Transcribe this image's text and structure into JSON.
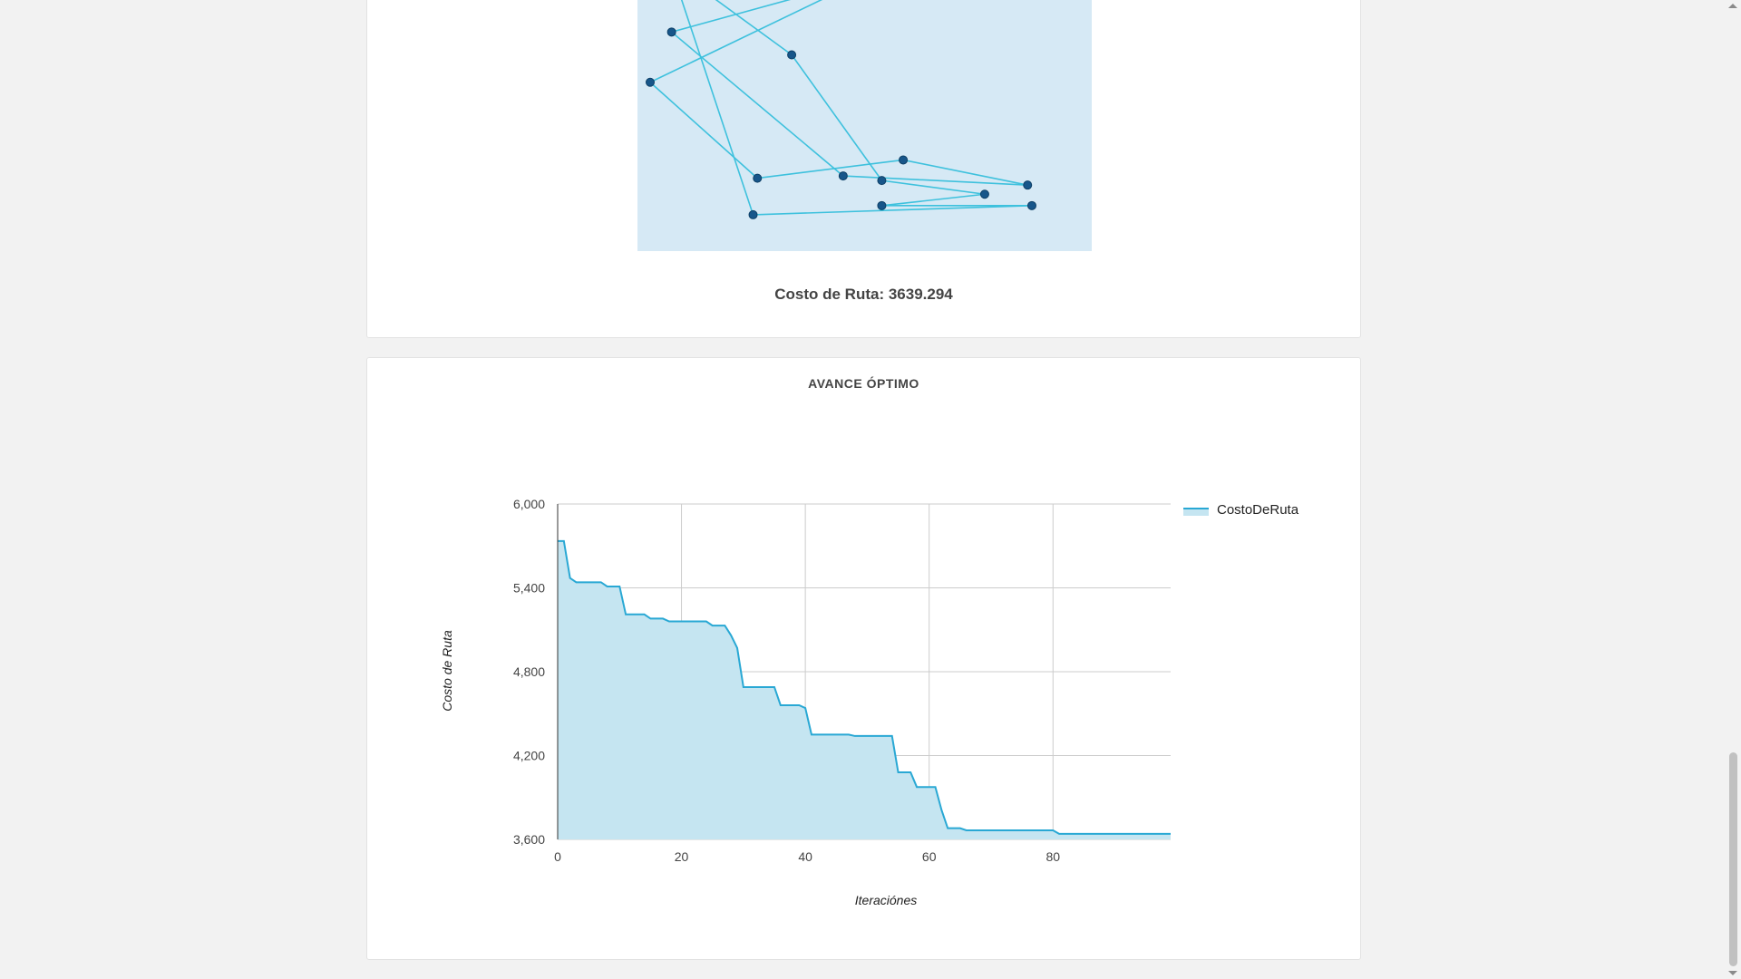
{
  "route_card": {
    "cost_text": "Costo de Ruta: 3639.294",
    "map": {
      "points": [
        {
          "x": 42,
          "y": 0
        },
        {
          "x": 0,
          "y": 38
        },
        {
          "x": 25,
          "y": 80
        },
        {
          "x": 59,
          "y": 72
        },
        {
          "x": 88,
          "y": 83
        },
        {
          "x": 45,
          "y": 79
        },
        {
          "x": 5,
          "y": 16
        },
        {
          "x": 36,
          "y": 0
        },
        {
          "x": 7,
          "y": 0
        },
        {
          "x": 24,
          "y": 96
        },
        {
          "x": 89,
          "y": 92
        },
        {
          "x": 54,
          "y": 92
        },
        {
          "x": 78,
          "y": 87
        },
        {
          "x": 54,
          "y": 81
        },
        {
          "x": 33,
          "y": 26
        },
        {
          "x": 14,
          "y": 0
        }
      ],
      "background": "#d6e9f5",
      "line_color": "#3ec1dd",
      "point_color": "#17568a"
    }
  },
  "progress_card": {
    "title": "AVANCE ÓPTIMO",
    "chart_data": {
      "type": "area",
      "title": "AVANCE ÓPTIMO",
      "xlabel": "Iteraciónes",
      "ylabel": "Costo de Ruta",
      "xlim": [
        0,
        99
      ],
      "ylim": [
        3600,
        6000
      ],
      "x_ticks": [
        0,
        20,
        40,
        60,
        80
      ],
      "x_tick_labels": [
        "0",
        "20",
        "40",
        "60",
        "80"
      ],
      "y_ticks": [
        3600,
        4200,
        4800,
        5400,
        6000
      ],
      "y_tick_labels": [
        "3,600",
        "4,200",
        "4,800",
        "5,400",
        "6,000"
      ],
      "grid": true,
      "legend": "right",
      "series": [
        {
          "name": "CostoDeRuta",
          "color": "#29a8d4",
          "fill": "#c5e5f1",
          "x": [
            0,
            1,
            2,
            3,
            4,
            5,
            6,
            7,
            8,
            9,
            10,
            11,
            12,
            13,
            14,
            15,
            16,
            17,
            18,
            19,
            20,
            21,
            22,
            23,
            24,
            25,
            26,
            27,
            28,
            29,
            30,
            31,
            32,
            33,
            34,
            35,
            36,
            37,
            38,
            39,
            40,
            41,
            42,
            43,
            44,
            45,
            46,
            47,
            48,
            49,
            50,
            51,
            52,
            53,
            54,
            55,
            56,
            57,
            58,
            59,
            60,
            61,
            62,
            63,
            64,
            65,
            66,
            67,
            68,
            69,
            70,
            71,
            72,
            73,
            74,
            75,
            76,
            77,
            78,
            79,
            80,
            81,
            82,
            83,
            84,
            85,
            86,
            87,
            88,
            89,
            90,
            91,
            92,
            93,
            94,
            95,
            96,
            97,
            98,
            99
          ],
          "values": [
            5735,
            5735,
            5470,
            5440,
            5440,
            5440,
            5440,
            5440,
            5410,
            5410,
            5410,
            5210,
            5210,
            5210,
            5210,
            5180,
            5180,
            5180,
            5160,
            5160,
            5160,
            5160,
            5160,
            5160,
            5160,
            5130,
            5130,
            5130,
            5060,
            4970,
            4690,
            4690,
            4690,
            4690,
            4690,
            4690,
            4560,
            4560,
            4560,
            4560,
            4540,
            4350,
            4350,
            4350,
            4350,
            4350,
            4350,
            4350,
            4340,
            4340,
            4340,
            4340,
            4340,
            4340,
            4340,
            4080,
            4080,
            4080,
            3975,
            3975,
            3975,
            3975,
            3810,
            3680,
            3680,
            3680,
            3665,
            3665,
            3665,
            3665,
            3665,
            3665,
            3665,
            3665,
            3665,
            3665,
            3665,
            3665,
            3665,
            3665,
            3665,
            3640,
            3640,
            3640,
            3640,
            3640,
            3640,
            3640,
            3640,
            3640,
            3640,
            3640,
            3640,
            3640,
            3640,
            3640,
            3640,
            3640,
            3640,
            3640
          ]
        }
      ]
    }
  }
}
